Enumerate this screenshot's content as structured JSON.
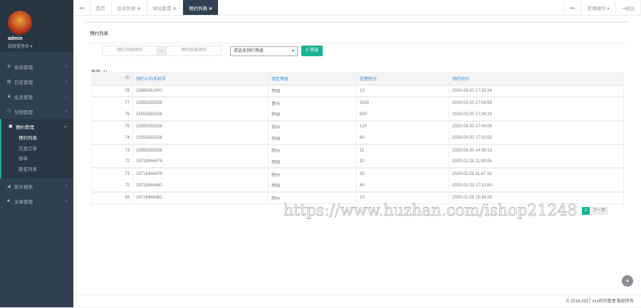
{
  "user": {
    "name": "admin",
    "role": "超级管理员 ▾"
  },
  "nav": [
    {
      "icon": "⚙",
      "label": "系统管理"
    },
    {
      "icon": "▤",
      "label": "日志管理"
    },
    {
      "icon": "♟",
      "label": "会员管理"
    },
    {
      "icon": "⚇",
      "label": "分销管理"
    },
    {
      "icon": "▣",
      "label": "预约管理"
    },
    {
      "icon": "◢",
      "label": "统计报表"
    },
    {
      "icon": "■",
      "label": "文章管理"
    }
  ],
  "subnav": [
    "预约列表",
    "交易订单",
    "排单",
    "匿名列表"
  ],
  "tabs": {
    "back": "◂◂",
    "items": [
      "首页",
      "会员列表 ⊗",
      "网站配置 ⊗",
      "预约列表 ⊗"
    ],
    "forward": "▸▸",
    "ops": "常用操作 ▾",
    "logout": "⇥退出"
  },
  "panel": {
    "title": "预约列表"
  },
  "filters": {
    "start": "预约开始时间",
    "sep": "—",
    "end": "预约结束时间",
    "select": "请选择预约等级",
    "button": "筛选"
  },
  "count": "数量: 11",
  "table": {
    "headers": [
      "ID",
      "预约人的手机号",
      "预定等级",
      "花费积分",
      "预约时间"
    ],
    "rows": [
      [
        "78",
        "15888261000",
        "帝国",
        "10",
        "2020-03-20 17:16:34"
      ],
      [
        "77",
        "15555355326",
        "贵州",
        "3100",
        "2020-03-20 17:04:54"
      ],
      [
        "76",
        "15555355326",
        "梦国",
        "600",
        "2020-03-20 17:04:23"
      ],
      [
        "75",
        "15555355326",
        "郑州",
        "120",
        "2020-03-20 17:04:08"
      ],
      [
        "74",
        "15555355326",
        "传国",
        "60",
        "2020-03-20 17:03:53"
      ],
      [
        "73",
        "15555355326",
        "西州",
        "11",
        "2020-03-20 14:39:13"
      ],
      [
        "72",
        "18718944479",
        "帝国",
        "20",
        "2020-02-29 11:49:05"
      ],
      [
        "71",
        "18718944479",
        "西州",
        "30",
        "2020-02-29 11:47:18"
      ],
      [
        "70",
        "18718944480",
        "帝国",
        "40",
        "2020-02-23 17:12:50"
      ],
      [
        "69",
        "18718944481",
        "西州",
        "10",
        "2020-01-08 15:44:28"
      ]
    ]
  },
  "pager": {
    "current": "1",
    "next": "下一页"
  },
  "watermark": "https://www.huzhan.com/ishop21248",
  "footer": "© 2016-2017 xxx后台管理 版权所有"
}
